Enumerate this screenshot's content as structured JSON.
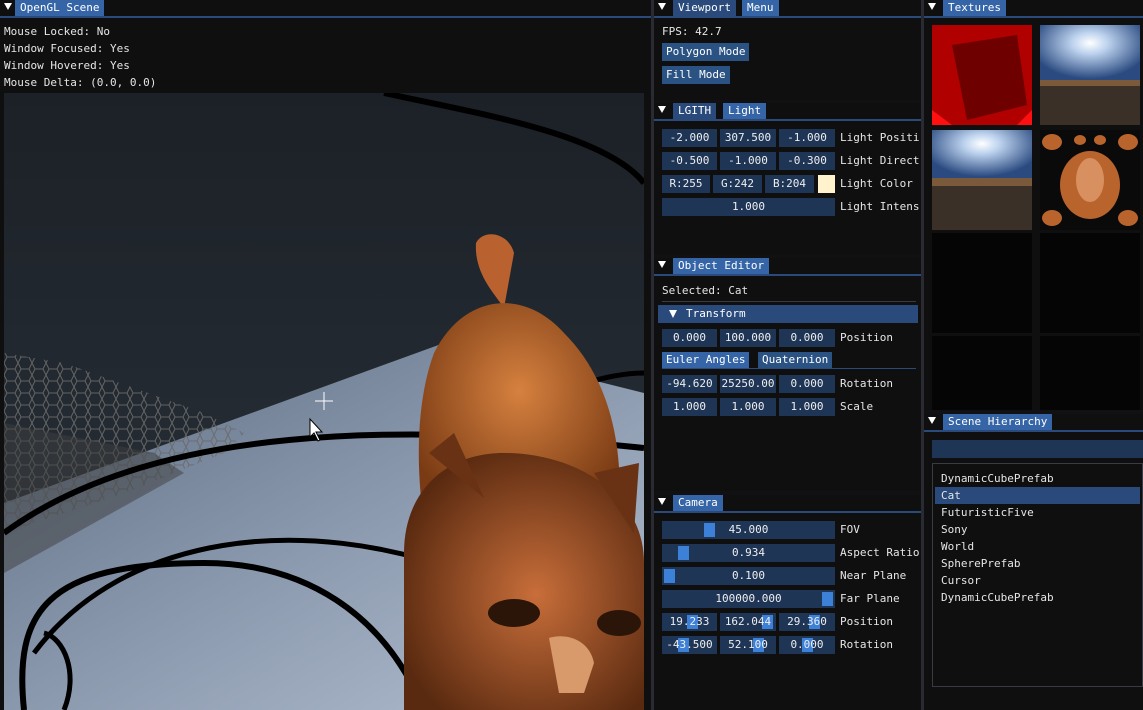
{
  "scene": {
    "title": "OpenGL Scene",
    "info": [
      "Mouse Locked: No",
      "Window Focused: Yes",
      "Window Hovered: Yes",
      "Mouse Delta: (0.0, 0.0)"
    ]
  },
  "viewport": {
    "tabs": [
      "Viewport",
      "Menu"
    ],
    "fps": "FPS: 42.7",
    "polygon_mode": "Polygon Mode",
    "fill_mode": "Fill Mode"
  },
  "light": {
    "tabs": [
      "LGITH",
      "Light"
    ],
    "position": {
      "values": [
        "-2.000",
        "307.500",
        "-1.000"
      ],
      "label": "Light Positi"
    },
    "direction": {
      "values": [
        "-0.500",
        "-1.000",
        "-0.300"
      ],
      "label": "Light Direct"
    },
    "color": {
      "values": [
        "R:255",
        "G:242",
        "B:204"
      ],
      "swatch": "#fff2cc",
      "label": "Light Color"
    },
    "intensity": {
      "value": "1.000",
      "label": "Light Intens"
    }
  },
  "object_editor": {
    "title": "Object Editor",
    "selected": "Selected: Cat",
    "transform_header": "Transform",
    "position": {
      "values": [
        "0.000",
        "100.000",
        "0.000"
      ],
      "label": "Position"
    },
    "euler_tab": "Euler Angles",
    "quaternion_tab": "Quaternion",
    "rotation": {
      "values": [
        "-94.620",
        "25250.00",
        "0.000"
      ],
      "label": "Rotation"
    },
    "scale": {
      "values": [
        "1.000",
        "1.000",
        "1.000"
      ],
      "label": "Scale"
    }
  },
  "camera": {
    "title": "Camera",
    "fov": {
      "value": "45.000",
      "label": "FOV"
    },
    "aspect": {
      "value": "0.934",
      "label": "Aspect Ratio"
    },
    "near": {
      "value": "0.100",
      "label": "Near Plane"
    },
    "far": {
      "value": "100000.000",
      "label": "Far Plane"
    },
    "position": {
      "values": [
        "19.233",
        "162.044",
        "29.360"
      ],
      "label": "Position"
    },
    "rotation": {
      "values": [
        "-43.500",
        "52.100",
        "0.000"
      ],
      "label": "Rotation"
    }
  },
  "textures": {
    "title": "Textures",
    "items": [
      "red-cube-texture",
      "skybox-texture",
      "skybox-texture-2",
      "cat-fur-texture",
      "empty-texture-slot",
      "empty-texture-slot",
      "empty-texture-slot",
      "empty-texture-slot"
    ]
  },
  "hierarchy": {
    "title": "Scene Hierarchy",
    "search_value": "",
    "items": [
      "DynamicCubePrefab",
      "Cat",
      "FuturisticFive",
      "Sony",
      "World",
      "SpherePrefab",
      "Cursor",
      "DynamicCubePrefab"
    ],
    "selected_index": 1
  },
  "colors": {
    "tab": "#294a7a",
    "active_tab": "#3565a6",
    "button": "#2a5282",
    "field": "#1f3555",
    "grab": "#3d80d8",
    "selection": "#294a7a"
  }
}
